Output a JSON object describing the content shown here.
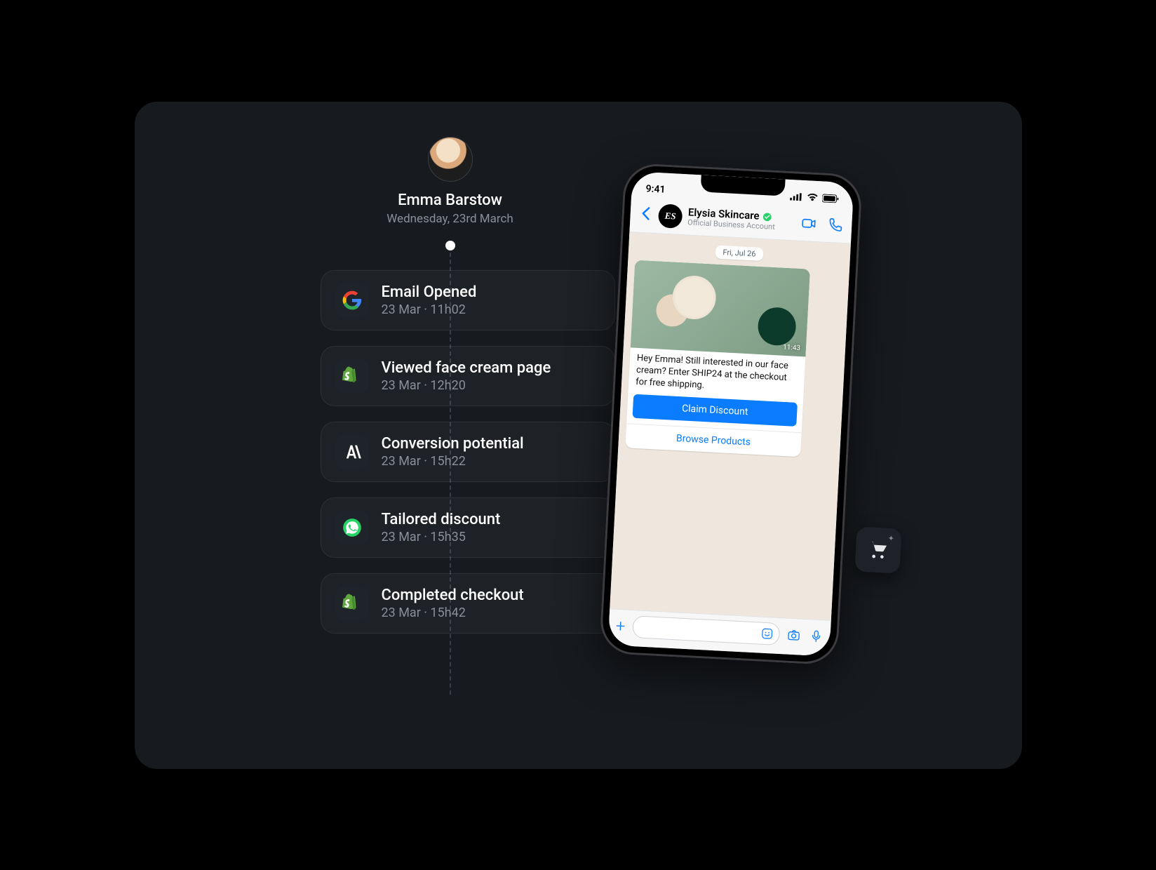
{
  "profile": {
    "name": "Emma Barstow",
    "date": "Wednesday, 23rd March"
  },
  "timeline": [
    {
      "icon": "google",
      "title": "Email Opened",
      "meta": "23 Mar · 11h02"
    },
    {
      "icon": "shopify",
      "title": "Viewed face cream page",
      "meta": "23 Mar · 12h20"
    },
    {
      "icon": "anthropic",
      "title": "Conversion potential",
      "meta": "23 Mar · 15h22"
    },
    {
      "icon": "whatsapp",
      "title": "Tailored discount",
      "meta": "23 Mar · 15h35"
    },
    {
      "icon": "shopify",
      "title": "Completed checkout",
      "meta": "23 Mar · 15h42"
    }
  ],
  "phone": {
    "status_time": "9:41",
    "business_name": "Elysia Skincare",
    "business_initials": "ES",
    "business_subtitle": "Official Business Account",
    "chat_date": "Fri, Jul 26",
    "message_text": "Hey Emma! Still interested in our face cream? Enter SHIP24 at the checkout for free shipping.",
    "message_time": "11:43",
    "btn_primary": "Claim Discount",
    "btn_secondary": "Browse Products"
  }
}
